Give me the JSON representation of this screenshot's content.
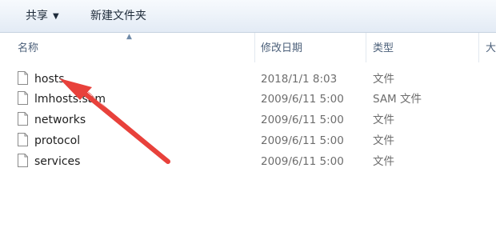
{
  "toolbar": {
    "share_label": "共享",
    "share_caret": "▼",
    "new_folder_label": "新建文件夹"
  },
  "columns": {
    "name": "名称",
    "modified": "修改日期",
    "type": "类型",
    "size": "大"
  },
  "files": [
    {
      "name": "hosts",
      "modified": "2018/1/1 8:03",
      "type": "文件"
    },
    {
      "name": "lmhosts.sam",
      "modified": "2009/6/11 5:00",
      "type": "SAM 文件"
    },
    {
      "name": "networks",
      "modified": "2009/6/11 5:00",
      "type": "文件"
    },
    {
      "name": "protocol",
      "modified": "2009/6/11 5:00",
      "type": "文件"
    },
    {
      "name": "services",
      "modified": "2009/6/11 5:00",
      "type": "文件"
    }
  ],
  "annotation": {
    "icon": "red-arrow-icon",
    "color": "#e8413b"
  },
  "icons": {
    "file": "file-icon",
    "sort": "sort-ascending-icon"
  }
}
